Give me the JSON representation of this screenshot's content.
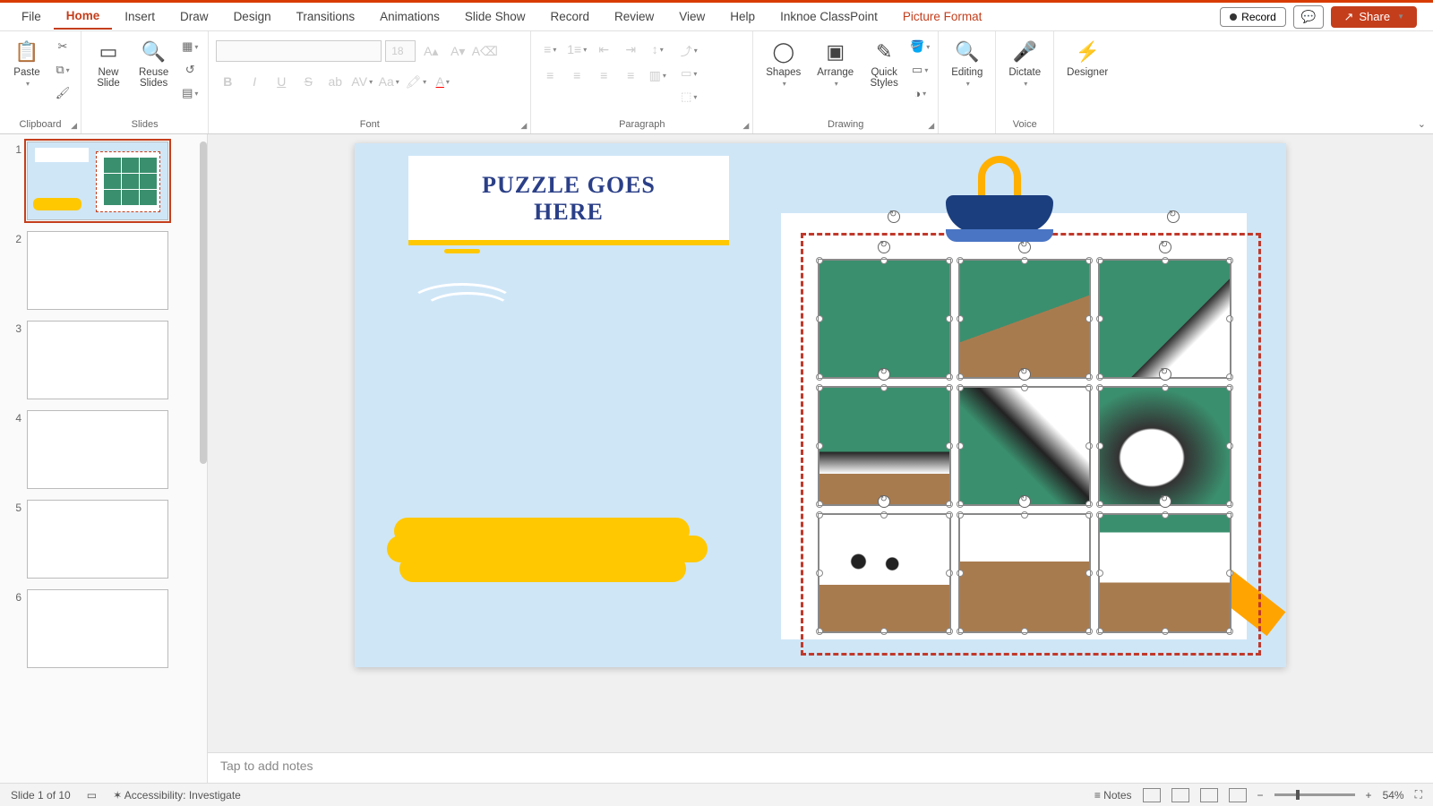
{
  "menu": {
    "items": [
      "File",
      "Home",
      "Insert",
      "Draw",
      "Design",
      "Transitions",
      "Animations",
      "Slide Show",
      "Record",
      "Review",
      "View",
      "Help",
      "Inknoe ClassPoint"
    ],
    "context_tab": "Picture Format",
    "active": "Home",
    "record": "Record",
    "share": "Share"
  },
  "ribbon": {
    "clipboard": {
      "paste": "Paste",
      "label": "Clipboard"
    },
    "slides": {
      "new_slide": "New\nSlide",
      "reuse": "Reuse\nSlides",
      "label": "Slides"
    },
    "font": {
      "name_placeholder": "",
      "size": "18",
      "label": "Font"
    },
    "paragraph": {
      "label": "Paragraph"
    },
    "drawing": {
      "shapes": "Shapes",
      "arrange": "Arrange",
      "quick": "Quick\nStyles",
      "label": "Drawing"
    },
    "editing": {
      "editing": "Editing"
    },
    "voice": {
      "dictate": "Dictate",
      "label": "Voice"
    },
    "designer": {
      "designer": "Designer"
    }
  },
  "slide": {
    "title": "PUZZLE GOES\nHERE"
  },
  "thumbnails": {
    "count": 6,
    "selected": 1
  },
  "notes": {
    "placeholder": "Tap to add notes"
  },
  "status": {
    "slide_info": "Slide 1 of 10",
    "accessibility": "Accessibility: Investigate",
    "notes_btn": "Notes",
    "zoom": "54%"
  }
}
